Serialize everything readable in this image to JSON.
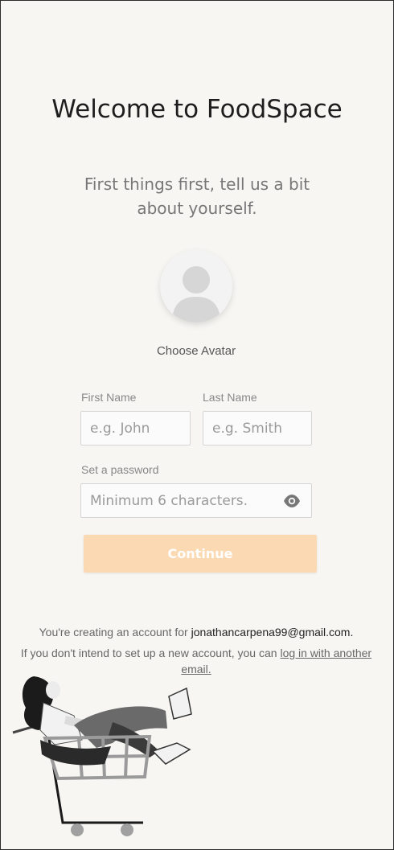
{
  "header": {
    "title": "Welcome to FoodSpace",
    "subtitle": "First things first, tell us a bit about yourself."
  },
  "avatar": {
    "icon": "user-avatar-icon",
    "choose_label": "Choose Avatar"
  },
  "form": {
    "first_name": {
      "label": "First Name",
      "placeholder": "e.g. John",
      "value": ""
    },
    "last_name": {
      "label": "Last Name",
      "placeholder": "e.g. Smith",
      "value": ""
    },
    "password": {
      "label": "Set a password",
      "placeholder": "Minimum 6 characters.",
      "value": "",
      "toggle_icon": "eye-icon"
    },
    "continue_label": "Continue"
  },
  "footer": {
    "account_prefix": "You're creating an account for",
    "email": "jonathancarpena99@gmail.com.",
    "alt_prefix": "If you don't intend to set up a new account, you can",
    "alt_link": "log in with another email."
  },
  "colors": {
    "background": "#f7f6f3",
    "button_disabled": "#fbd9b3"
  }
}
